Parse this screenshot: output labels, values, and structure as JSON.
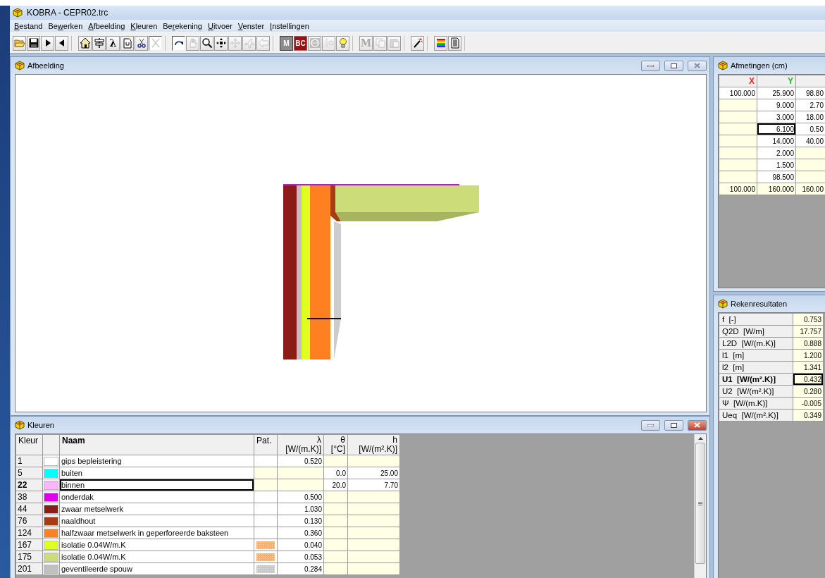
{
  "app": {
    "title": "KOBRA - CEPR02.trc"
  },
  "menu": [
    {
      "key": "B",
      "rest": "estand"
    },
    {
      "lead": "Be",
      "key": "w",
      "rest": "erken"
    },
    {
      "key": "A",
      "rest": "fbeelding"
    },
    {
      "key": "K",
      "rest": "leuren"
    },
    {
      "lead": "Be",
      "key": "r",
      "rest": "ekening"
    },
    {
      "key": "U",
      "rest": "itvoer"
    },
    {
      "key": "V",
      "rest": "enster"
    },
    {
      "key": "I",
      "rest": "nstellingen"
    }
  ],
  "toolbar": [
    [
      {
        "kind": "icon",
        "disabled": false,
        "pressed": false
      },
      {
        "kind": "icon",
        "disabled": false,
        "pressed": false
      },
      {
        "kind": "icon",
        "disabled": false,
        "pressed": false
      },
      {
        "kind": "icon",
        "disabled": false,
        "pressed": false
      }
    ],
    [
      {
        "kind": "icon",
        "disabled": false,
        "pressed": false
      },
      {
        "kind": "icon",
        "disabled": false,
        "pressed": false
      },
      {
        "kind": "glyph",
        "label": "λ",
        "disabled": false,
        "pressed": false
      },
      {
        "kind": "icon",
        "disabled": false,
        "pressed": false
      },
      {
        "kind": "icon",
        "disabled": false,
        "pressed": false
      },
      {
        "kind": "icon",
        "disabled": true,
        "pressed": true
      }
    ],
    [
      {
        "kind": "icon",
        "disabled": false,
        "pressed": true
      },
      {
        "kind": "icon",
        "disabled": true,
        "pressed": false
      },
      {
        "kind": "icon",
        "disabled": false,
        "pressed": false
      },
      {
        "kind": "icon",
        "disabled": false,
        "pressed": false
      },
      {
        "kind": "icon",
        "disabled": true,
        "pressed": false
      },
      {
        "kind": "icon",
        "disabled": true,
        "pressed": false
      },
      {
        "kind": "icon",
        "disabled": true,
        "pressed": false
      }
    ],
    [
      {
        "kind": "badge",
        "label": "M",
        "color": "#8c8c8c",
        "disabled": false,
        "pressed": true
      },
      {
        "kind": "badge",
        "label": "BC",
        "color": "#9b1010",
        "disabled": false,
        "pressed": false
      },
      {
        "kind": "icon",
        "disabled": true,
        "pressed": false
      },
      {
        "kind": "icon",
        "disabled": true,
        "pressed": false
      },
      {
        "kind": "icon",
        "disabled": false,
        "pressed": false
      }
    ],
    [
      {
        "kind": "glyph",
        "label": "M",
        "disabled": true,
        "pressed": false
      },
      {
        "kind": "icon",
        "disabled": true,
        "pressed": false
      },
      {
        "kind": "icon",
        "disabled": true,
        "pressed": false
      }
    ],
    [
      {
        "kind": "icon",
        "disabled": false,
        "pressed": false
      }
    ],
    [
      {
        "kind": "icon",
        "disabled": false,
        "pressed": false
      },
      {
        "kind": "icon",
        "disabled": false,
        "pressed": false
      }
    ]
  ],
  "drawing_window": {
    "title": "Afbeelding",
    "active": false
  },
  "dimensions": {
    "title": "Afmetingen (cm)",
    "columns": [
      {
        "label": "X",
        "color": "#ff2020"
      },
      {
        "label": "Y",
        "color": "#20c020"
      }
    ],
    "rows": [
      {
        "kind": "data",
        "cells": [
          {
            "text": "100.000",
            "selected": false
          },
          {
            "text": "25.900",
            "selected": false
          },
          {
            "text": "98.80",
            "selected": false
          }
        ]
      },
      {
        "kind": "data",
        "cells": [
          {
            "selected": false
          },
          {
            "text": "9.000",
            "selected": false
          },
          {
            "text": "2.70",
            "selected": false
          }
        ]
      },
      {
        "kind": "data",
        "cells": [
          {
            "selected": false
          },
          {
            "text": "3.000",
            "selected": false
          },
          {
            "text": "18.00",
            "selected": false
          }
        ]
      },
      {
        "kind": "data",
        "cells": [
          {
            "selected": false
          },
          {
            "text": "6.100",
            "selected": true
          },
          {
            "text": "0.50",
            "selected": false
          }
        ]
      },
      {
        "kind": "data",
        "cells": [
          {
            "selected": false
          },
          {
            "text": "14.000",
            "selected": false
          },
          {
            "text": "40.00",
            "selected": false
          }
        ]
      },
      {
        "kind": "data",
        "cells": [
          {
            "selected": false
          },
          {
            "text": "2.000",
            "selected": false
          },
          {
            "selected": false
          }
        ]
      },
      {
        "kind": "data",
        "cells": [
          {
            "selected": false
          },
          {
            "text": "1.500",
            "selected": false
          },
          {
            "selected": false
          }
        ]
      },
      {
        "kind": "data",
        "cells": [
          {
            "selected": false
          },
          {
            "text": "98.500",
            "selected": false
          },
          {
            "selected": false
          }
        ]
      },
      {
        "kind": "total",
        "cells": [
          {
            "text": "100.000",
            "selected": false
          },
          {
            "text": "160.000",
            "selected": false
          },
          {
            "text": "160.00",
            "selected": false
          }
        ]
      }
    ]
  },
  "results": {
    "title": "Rekenresultaten",
    "rows": [
      {
        "label": "f  [-]",
        "value": "0.753",
        "selected": false
      },
      {
        "label": "Q2D  [W/m]",
        "value": "17.757",
        "selected": false
      },
      {
        "label": "L2D  [W/(m.K)]",
        "value": "0.888",
        "selected": false
      },
      {
        "label": "l1  [m]",
        "value": "1.200",
        "selected": false
      },
      {
        "label": "l2  [m]",
        "value": "1.341",
        "selected": false
      },
      {
        "label": "U1  [W/(m².K)]",
        "value": "0.432",
        "selected": true
      },
      {
        "label": "U2  [W/(m².K)]",
        "value": "0.280",
        "selected": false
      },
      {
        "label": "Ψ  [W/(m.K)]",
        "value": "-0.005",
        "selected": false
      },
      {
        "label": "Ueq  [W/(m².K)]",
        "value": "0.349",
        "selected": false
      }
    ]
  },
  "colors": {
    "title": "Kleuren",
    "active": true,
    "columns": {
      "number": "Kleur",
      "name": "Naam",
      "pattern": "Pat.",
      "lambda": {
        "symbol": "λ",
        "unit": "[W/(m.K)]"
      },
      "theta": {
        "symbol": "θ",
        "unit": "[°C]"
      },
      "h": {
        "symbol": "h",
        "unit": "[W/(m².K)]"
      }
    },
    "rows": [
      {
        "number": "1",
        "color": "#ffffff",
        "name": "gips bepleistering",
        "kind": "material",
        "lambda": "0.520",
        "selected": false
      },
      {
        "number": "5",
        "color": "#00ffff",
        "name": "buiten",
        "kind": "boundary",
        "theta": "0.0",
        "h": "25.00",
        "selected": false
      },
      {
        "number": "22",
        "color": "#ffb4ff",
        "name": "binnen",
        "kind": "boundary",
        "theta": "20.0",
        "h": "7.70",
        "selected": true
      },
      {
        "number": "38",
        "color": "#e000f0",
        "name": "onderdak",
        "kind": "material",
        "lambda": "0.500",
        "selected": false
      },
      {
        "number": "44",
        "color": "#8a1e16",
        "name": "zwaar metselwerk",
        "kind": "material",
        "lambda": "1.030",
        "selected": false
      },
      {
        "number": "76",
        "color": "#a43e12",
        "name": "naaldhout",
        "kind": "material",
        "lambda": "0.130",
        "selected": false
      },
      {
        "number": "124",
        "color": "#ff8020",
        "name": "halfzwaar metselwerk in geperforeerde baksteen",
        "kind": "material",
        "lambda": "0.360",
        "selected": false
      },
      {
        "number": "167",
        "color": "#e0ff20",
        "name": "isolatie 0.04W/m.K",
        "kind": "material",
        "pattern": {
          "color": "#f8b070"
        },
        "lambda": "0.040",
        "selected": false
      },
      {
        "number": "175",
        "color": "#cbdc78",
        "name": "isolatie 0.04W/m.K",
        "kind": "material",
        "pattern": {
          "color": "#f8b070"
        },
        "lambda": "0.053",
        "selected": false
      },
      {
        "number": "201",
        "color": "#c0c0c0",
        "name": "geventileerde spouw",
        "kind": "material",
        "pattern": {
          "color": "#c8c8c8"
        },
        "lambda": "0.284",
        "selected": false
      }
    ]
  }
}
